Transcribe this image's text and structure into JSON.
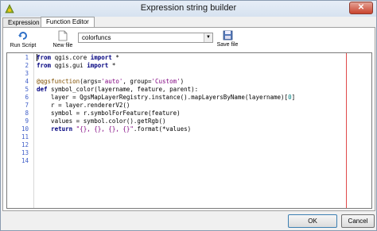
{
  "window": {
    "title": "Expression string builder",
    "close_label": "✕"
  },
  "tabs": [
    {
      "label": "Expression"
    },
    {
      "label": "Function Editor"
    }
  ],
  "toolbar": {
    "run_script_label": "Run Script",
    "new_file_label": "New file",
    "save_file_label": "Save file",
    "file_combo_value": "colorfuncs"
  },
  "editor": {
    "line_numbers": [
      "1",
      "2",
      "3",
      "4",
      "5",
      "6",
      "7",
      "8",
      "9",
      "10",
      "11",
      "12",
      "13",
      "14"
    ],
    "lines": [
      "from qgis.core import *",
      "from qgis.gui import *",
      "",
      "@qgsfunction(args='auto', group='Custom')",
      "def symbol_color(layername, feature, parent):",
      "    layer = QgsMapLayerRegistry.instance().mapLayersByName(layername)[0]",
      "    r = layer.rendererV2()",
      "    symbol = r.symbolForFeature(feature)",
      "    values = symbol.color().getRgb()",
      "    return \"{}, {}, {}, {}\".format(*values)",
      "",
      "",
      "",
      ""
    ]
  },
  "buttons": {
    "ok_label": "OK",
    "cancel_label": "Cancel"
  }
}
